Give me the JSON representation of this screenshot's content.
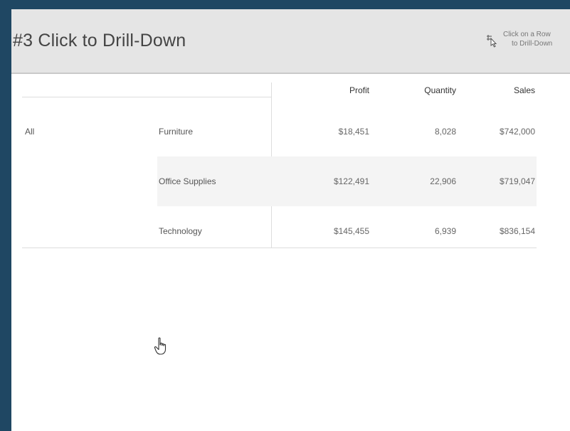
{
  "header": {
    "title": "#3 Click to Drill-Down",
    "hint_line1": "Click on a Row",
    "hint_line2": "to Drill-Down"
  },
  "table": {
    "columns": [
      "Profit",
      "Quantity",
      "Sales"
    ],
    "group_label": "All",
    "rows": [
      {
        "category": "Furniture",
        "profit": "$18,451",
        "quantity": "8,028",
        "sales": "$742,000"
      },
      {
        "category": "Office Supplies",
        "profit": "$122,491",
        "quantity": "22,906",
        "sales": "$719,047"
      },
      {
        "category": "Technology",
        "profit": "$145,455",
        "quantity": "6,939",
        "sales": "$836,154"
      }
    ]
  },
  "icons": {
    "hint": "pointer-drill-icon",
    "cursor": "hand-cursor-icon"
  }
}
